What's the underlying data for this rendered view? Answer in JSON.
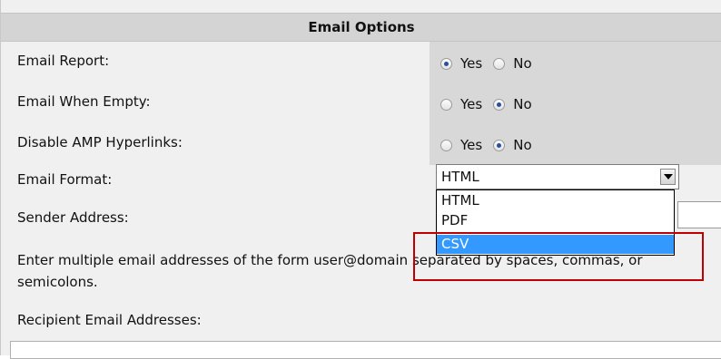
{
  "section_title": "Email Options",
  "rows": {
    "email_report": {
      "label": "Email Report:",
      "yes": "Yes",
      "no": "No",
      "selected": "Yes"
    },
    "email_when_empty": {
      "label": "Email When Empty:",
      "yes": "Yes",
      "no": "No",
      "selected": "No"
    },
    "disable_amp_hyperlinks": {
      "label": "Disable AMP Hyperlinks:",
      "yes": "Yes",
      "no": "No",
      "selected": "No"
    },
    "email_format": {
      "label": "Email Format:",
      "value": "HTML",
      "options": [
        "HTML",
        "PDF",
        "CSV"
      ],
      "highlighted_option": "CSV"
    },
    "sender_address": {
      "label": "Sender Address:",
      "value": ""
    }
  },
  "help_text": "Enter multiple email addresses of the form user@domain separated by spaces, commas, or semicolons.",
  "recipients": {
    "label": "Recipient Email Addresses:",
    "value": ""
  },
  "colors": {
    "highlight": "#3399ff",
    "annotation": "#c00000"
  }
}
